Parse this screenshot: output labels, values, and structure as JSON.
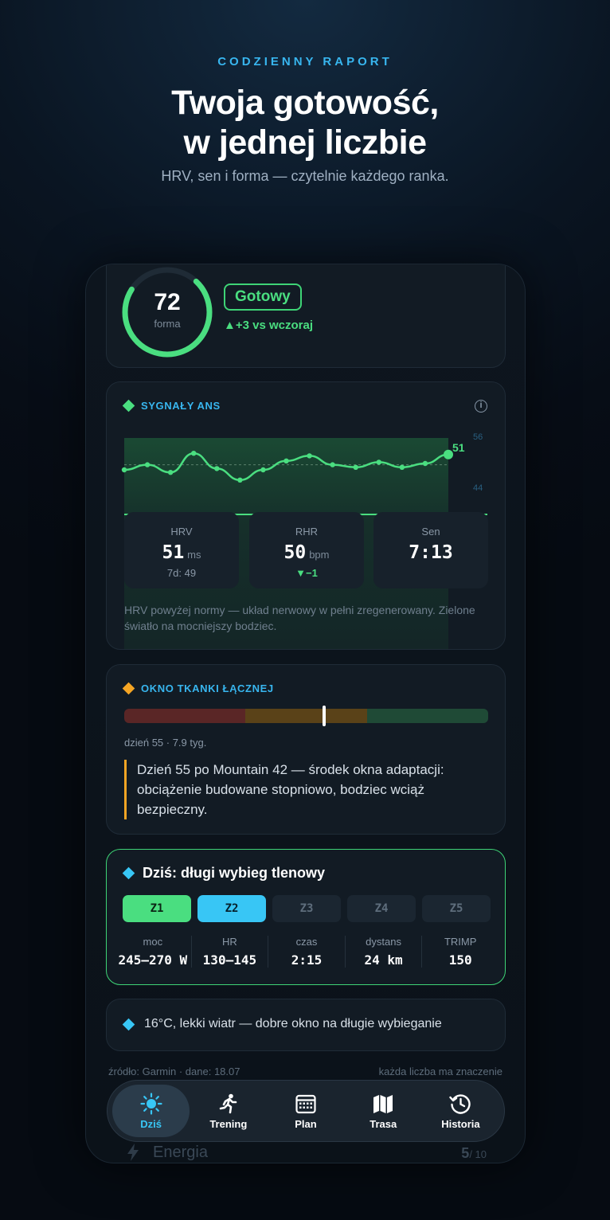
{
  "hero": {
    "eyebrow": "CODZIENNY RAPORT",
    "headline_line1": "Twoja gotowość,",
    "headline_line2": "w jednej liczbie",
    "subline": "HRV, sen i forma — czytelnie każdego ranka."
  },
  "readiness": {
    "score": "72",
    "score_label": "forma",
    "score_fraction": 0.72,
    "status": "Gotowy",
    "delta": "▲+3 vs wczoraj"
  },
  "ans": {
    "title": "SYGNAŁY ANS",
    "chart_last_label": "51",
    "y_top": "56",
    "y_bottom": "44",
    "hrv": {
      "label": "HRV",
      "value": "51",
      "unit": "ms",
      "sub": "7d: 49"
    },
    "rhr": {
      "label": "RHR",
      "value": "50",
      "unit": "bpm",
      "sub": "▼−1"
    },
    "sleep": {
      "label": "Sen",
      "value": "7:13"
    },
    "note": "HRV powyżej normy — układ nerwowy w pełni zregenerowany. Zielone światło na mocniejszy bodziec."
  },
  "chart_data": {
    "type": "line",
    "ylim": [
      44,
      56
    ],
    "series": [
      {
        "values": [
          50.5,
          50.9,
          50.3,
          51.8,
          50.6,
          49.7,
          50.5,
          51.2,
          51.6,
          50.9,
          50.7,
          51.1,
          50.7,
          51.0,
          51.7
        ]
      }
    ],
    "baseline": 50.9
  },
  "tissue": {
    "title": "OKNO TKANKI ŁĄCZNEJ",
    "day_label": "dzień 55 · 7.9 tyg.",
    "position_fraction": 0.55,
    "quote": "Dzień 55 po Mountain 42 — środek okna adaptacji: obciążenie budowane stopniowo, bodziec wciąż bezpieczny."
  },
  "workout": {
    "title": "Dziś: długi wybieg tlenowy",
    "zones": [
      "Z1",
      "Z2",
      "Z3",
      "Z4",
      "Z5"
    ],
    "metrics": [
      {
        "label": "moc",
        "value": "245–270 W"
      },
      {
        "label": "HR",
        "value": "130–145"
      },
      {
        "label": "czas",
        "value": "2:15"
      },
      {
        "label": "dystans",
        "value": "24 km"
      },
      {
        "label": "TRIMP",
        "value": "150"
      }
    ]
  },
  "weather": {
    "text": "16°C, lekki wiatr — dobre okno na długie wybieganie"
  },
  "footer": {
    "source": "źródło: Garmin · dane: 18.07",
    "tagline": "każda liczba ma znaczenie"
  },
  "energy": {
    "label": "Energia",
    "value": "5",
    "max": "/ 10"
  },
  "tabs": [
    {
      "label": "Dziś"
    },
    {
      "label": "Trening"
    },
    {
      "label": "Plan"
    },
    {
      "label": "Trasa"
    },
    {
      "label": "Historia"
    }
  ],
  "colors": {
    "accent_blue": "#38b6ef",
    "accent_green": "#4ade80",
    "accent_orange": "#f5a524"
  }
}
